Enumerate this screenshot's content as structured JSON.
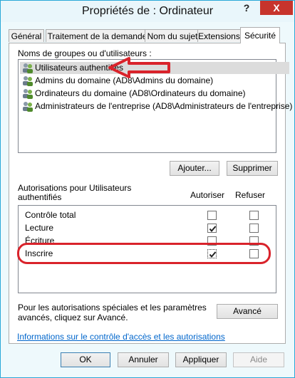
{
  "window": {
    "title": "Propriétés de : Ordinateur",
    "help": "?",
    "close": "X"
  },
  "tabs": [
    {
      "label": "Général"
    },
    {
      "label": "Traitement de la demande"
    },
    {
      "label": "Nom du sujet"
    },
    {
      "label": "Extensions"
    },
    {
      "label": "Sécurité",
      "active": true
    }
  ],
  "groups": {
    "label": "Noms de groupes ou d'utilisateurs :",
    "items": [
      {
        "label": "Utilisateurs authentifiés",
        "selected": true
      },
      {
        "label": "Admins du domaine (AD8\\Admins du domaine)"
      },
      {
        "label": "Ordinateurs du domaine (AD8\\Ordinateurs du domaine)"
      },
      {
        "label": "Administrateurs de l'entreprise (AD8\\Administrateurs de l'entreprise)"
      }
    ],
    "add_button": "Ajouter...",
    "remove_button": "Supprimer"
  },
  "permissions": {
    "label_line1": "Autorisations pour Utilisateurs",
    "label_line2": "authentifiés",
    "col_allow": "Autoriser",
    "col_deny": "Refuser",
    "rows": [
      {
        "name": "Contrôle total",
        "allow": false,
        "deny": false
      },
      {
        "name": "Lecture",
        "allow": true,
        "deny": false
      },
      {
        "name": "Écriture",
        "allow": false,
        "deny": false
      },
      {
        "name": "Inscrire",
        "allow": true,
        "deny": false
      }
    ]
  },
  "special": {
    "line1": "Pour les autorisations spéciales et les paramètres",
    "line2": "avancés, cliquez sur Avancé.",
    "advanced_button": "Avancé"
  },
  "link": "Informations sur le contrôle d'accès et les autorisations",
  "footer": {
    "ok": "OK",
    "cancel": "Annuler",
    "apply": "Appliquer",
    "help": "Aide"
  },
  "colors": {
    "window_border": "#2aa8d8",
    "close_button": "#c7342c",
    "annotation": "#d9232b",
    "link": "#0066cc"
  }
}
